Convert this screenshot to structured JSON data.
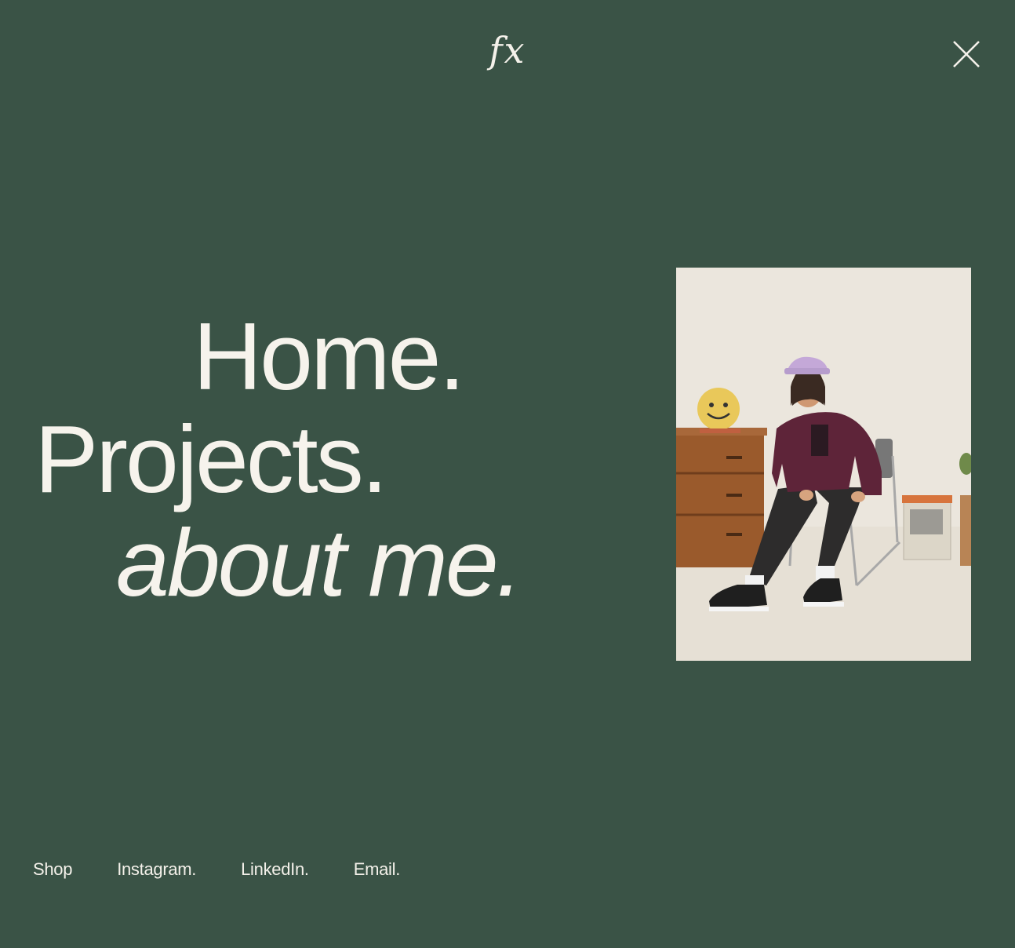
{
  "header": {
    "logo_text": "fx",
    "close_icon": "close-icon"
  },
  "nav": {
    "items": [
      {
        "label": "Home."
      },
      {
        "label": "Projects."
      },
      {
        "label": "about me."
      }
    ]
  },
  "footer": {
    "links": [
      {
        "label": "Shop"
      },
      {
        "label": "Instagram."
      },
      {
        "label": "LinkedIn."
      },
      {
        "label": "Email."
      }
    ]
  },
  "colors": {
    "background": "#3a5346",
    "text": "#f6f3ec"
  }
}
